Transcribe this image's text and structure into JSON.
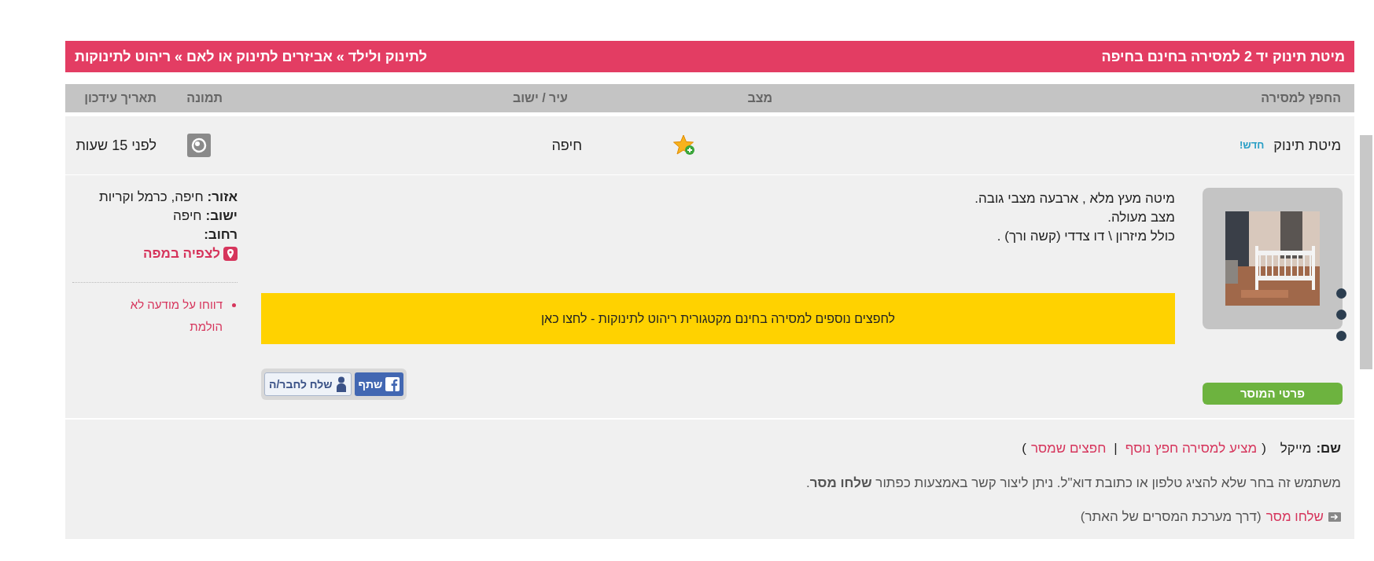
{
  "header": {
    "title": "מיטת תינוק יד 2 למסירה בחינם בחיפה",
    "breadcrumb": "לתינוק ולילד » אביזרים לתינוק או לאם » ריהוט לתינוקות"
  },
  "columns": [
    "החפץ למסירה",
    "מצב",
    "עיר / ישוב",
    "תמונה",
    "תאריך עידכון"
  ],
  "listing": {
    "title": "מיטת תינוק",
    "badge": "חדש!",
    "city": "חיפה",
    "updated": "לפני 15 שעות"
  },
  "details": {
    "description": [
      "מיטה מעץ מלא , ארבעה מצבי גובה.",
      "מצב מעולה.",
      "כולל מיזרון \\ דו צדדי (קשה ורך) ."
    ],
    "more_link": "לחפצים נוספים למסירה בחינם מקטגורית ריהוט לתינוקות - לחצו כאן",
    "share_button": "שתף",
    "send_friend_button": "שלח לחבר/ה",
    "seller_button": "פרטי המוסר",
    "location": [
      {
        "label": "אזור:",
        "value": "חיפה, כרמל וקריות"
      },
      {
        "label": "ישוב:",
        "value": "חיפה"
      },
      {
        "label": "רחוב:"
      }
    ],
    "map_link": "לצפיה במפה",
    "report_link": "דווחו על מודעה לא הולמת"
  },
  "seller": {
    "name_label": "שם:",
    "name": "מייקל",
    "paren_open": "(",
    "links": [
      "מציע למסירה חפץ נוסף",
      "חפצים שמסר"
    ],
    "separator": "|",
    "paren_close": ")",
    "notice": "משתמש זה בחר שלא להציג טלפון או כתובת דוא\"ל. ניתן ליצור קשר באמצעות כפתור **שלחו מסר**.",
    "send_link": "שלחו מסר",
    "send_note": "(דרך מערכת המסרים של האתר)"
  }
}
